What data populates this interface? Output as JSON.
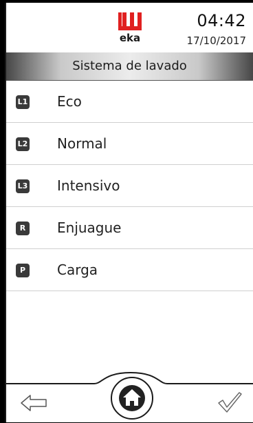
{
  "header": {
    "brand": "eka",
    "time": "04:42",
    "date": "17/10/2017"
  },
  "title": "Sistema de lavado",
  "menu": {
    "items": [
      {
        "badge": "L1",
        "label": "Eco"
      },
      {
        "badge": "L2",
        "label": "Normal"
      },
      {
        "badge": "L3",
        "label": "Intensivo"
      },
      {
        "badge": "R",
        "label": "Enjuague"
      },
      {
        "badge": "P",
        "label": "Carga"
      }
    ]
  },
  "footer": {
    "back_icon": "arrow-left-icon",
    "home_icon": "home-icon",
    "confirm_icon": "checkmark-icon"
  },
  "colors": {
    "brand_red": "#e02020",
    "badge_bg": "#3a3a3a",
    "title_bar_edge": "#474747"
  }
}
